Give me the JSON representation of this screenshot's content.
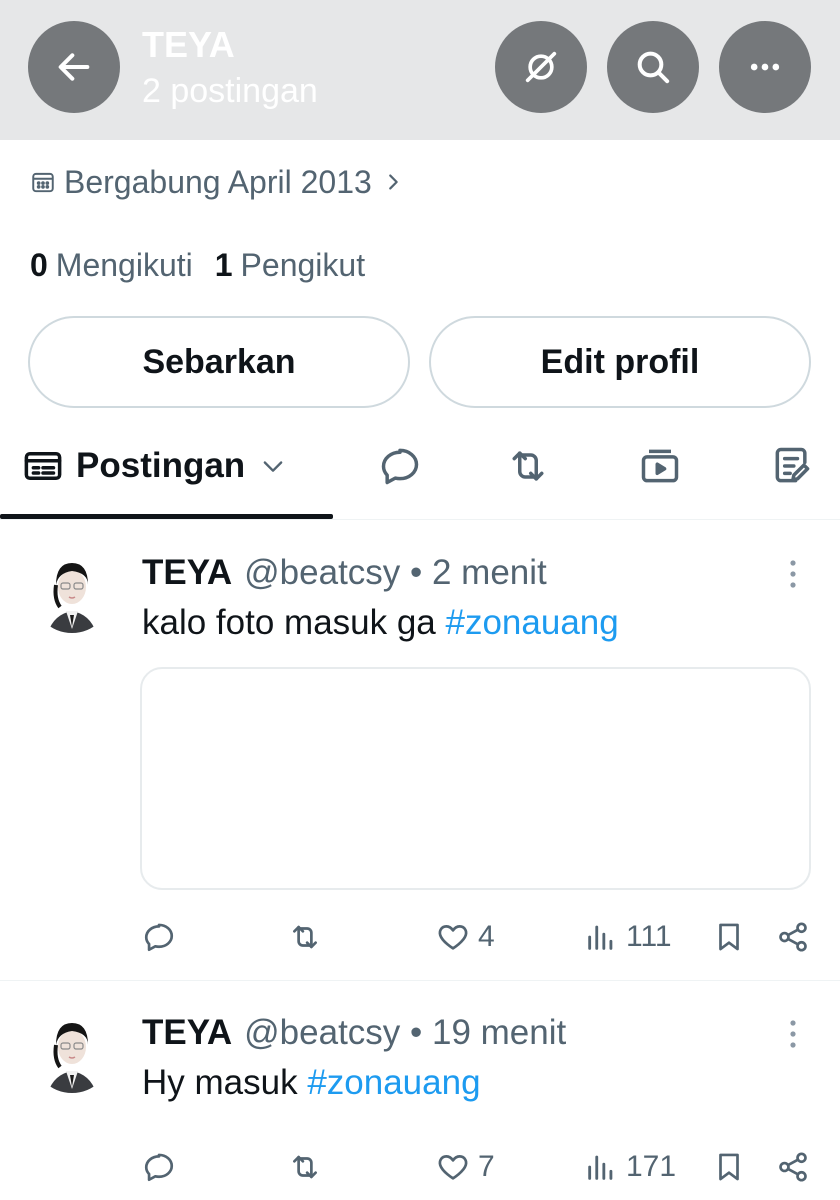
{
  "header": {
    "title": "TEYA",
    "subtitle": "2 postingan",
    "icons": {
      "back": "arrow-left-icon",
      "grok": "grok-icon",
      "search": "search-icon",
      "more": "more-horizontal-icon"
    }
  },
  "profile": {
    "joined": "Bergabung April 2013",
    "following_count": "0",
    "following_label": "Mengikuti",
    "followers_count": "1",
    "followers_label": "Pengikut",
    "share_label": "Sebarkan",
    "edit_label": "Edit profil"
  },
  "tabs": {
    "posts_label": "Postingan",
    "icons": [
      "replies-icon",
      "reposts-icon",
      "media-icon",
      "articles-icon"
    ]
  },
  "posts": [
    {
      "name": "TEYA",
      "meta": "@beatcsy • 2 menit",
      "text": "kalo foto masuk ga ",
      "hashtag": "#zonauang",
      "likes": "4",
      "views": "111"
    },
    {
      "name": "TEYA",
      "meta": "@beatcsy • 19 menit",
      "text": "Hy masuk ",
      "hashtag": "#zonauang",
      "likes": "7",
      "views": "171"
    }
  ],
  "colors": {
    "header_bg": "#e6e7e8",
    "header_button": "#75787b",
    "text_primary": "#0f1419",
    "text_secondary": "#536471",
    "link": "#1d9bf0",
    "border": "#cfd9de"
  }
}
